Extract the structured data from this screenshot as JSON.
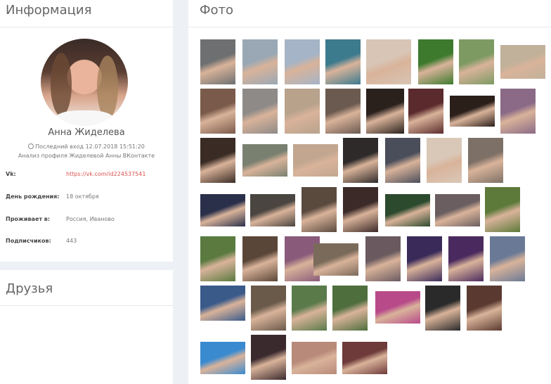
{
  "info": {
    "title": "Информация",
    "name": "Анна Жиделева",
    "last_seen": "Последний вход 12.07.2018 15:51:20",
    "analysis": "Анализ профиля Жиделевой Анны ВКонтакте",
    "rows": [
      {
        "label": "Vk:",
        "value": "https://vk.com/id224537541"
      },
      {
        "label": "День рождения:",
        "value": "18 октября"
      },
      {
        "label": "Проживает в:",
        "value": "Россия, Иваново"
      },
      {
        "label": "Подписчиков:",
        "value": "443"
      }
    ]
  },
  "friends": {
    "title": "Друзья"
  },
  "photos": {
    "title": "Фото",
    "colors": [
      [
        "#6d6f70",
        "#9aa8b5",
        "#a5b4c7",
        "#3c7a8e",
        "#d8c5b5",
        "#3d7a2e",
        "#7d9a63",
        "#c1b19a"
      ],
      [
        "#7a5a4a",
        "#8e8a88",
        "#b8a28c",
        "#6b5a50",
        "#2a211d",
        "#5a2a2c",
        "#2b1f1a",
        "#8a6a86"
      ],
      [
        "#3a2c25",
        "#7a8070",
        "#c2a690",
        "#2e2a2a",
        "#4a4e5a",
        "#d9c8b8",
        "#7d7066"
      ],
      [
        "#2a2f4a",
        "#4a4540",
        "#5a4a3e",
        "#3b2a28",
        "#2c4a2e",
        "#6a5e60",
        "#5d7a3a"
      ],
      [
        "#5a7a40",
        "#5a4638",
        "#8a5a7a",
        "#7a6a5a",
        "#6a5a60",
        "#3a2a5a",
        "#4a2a5e",
        "#6a7a96"
      ],
      [
        "#3a5a8a",
        "#6a5a4a",
        "#5a7a4a",
        "#4e6e3e",
        "#b84a8a",
        "#2a2a2a",
        "#5a3a30"
      ],
      [
        "#3a8ad0",
        "#3a2a2e",
        "#b88a7a",
        "#6e3a3a"
      ]
    ]
  }
}
